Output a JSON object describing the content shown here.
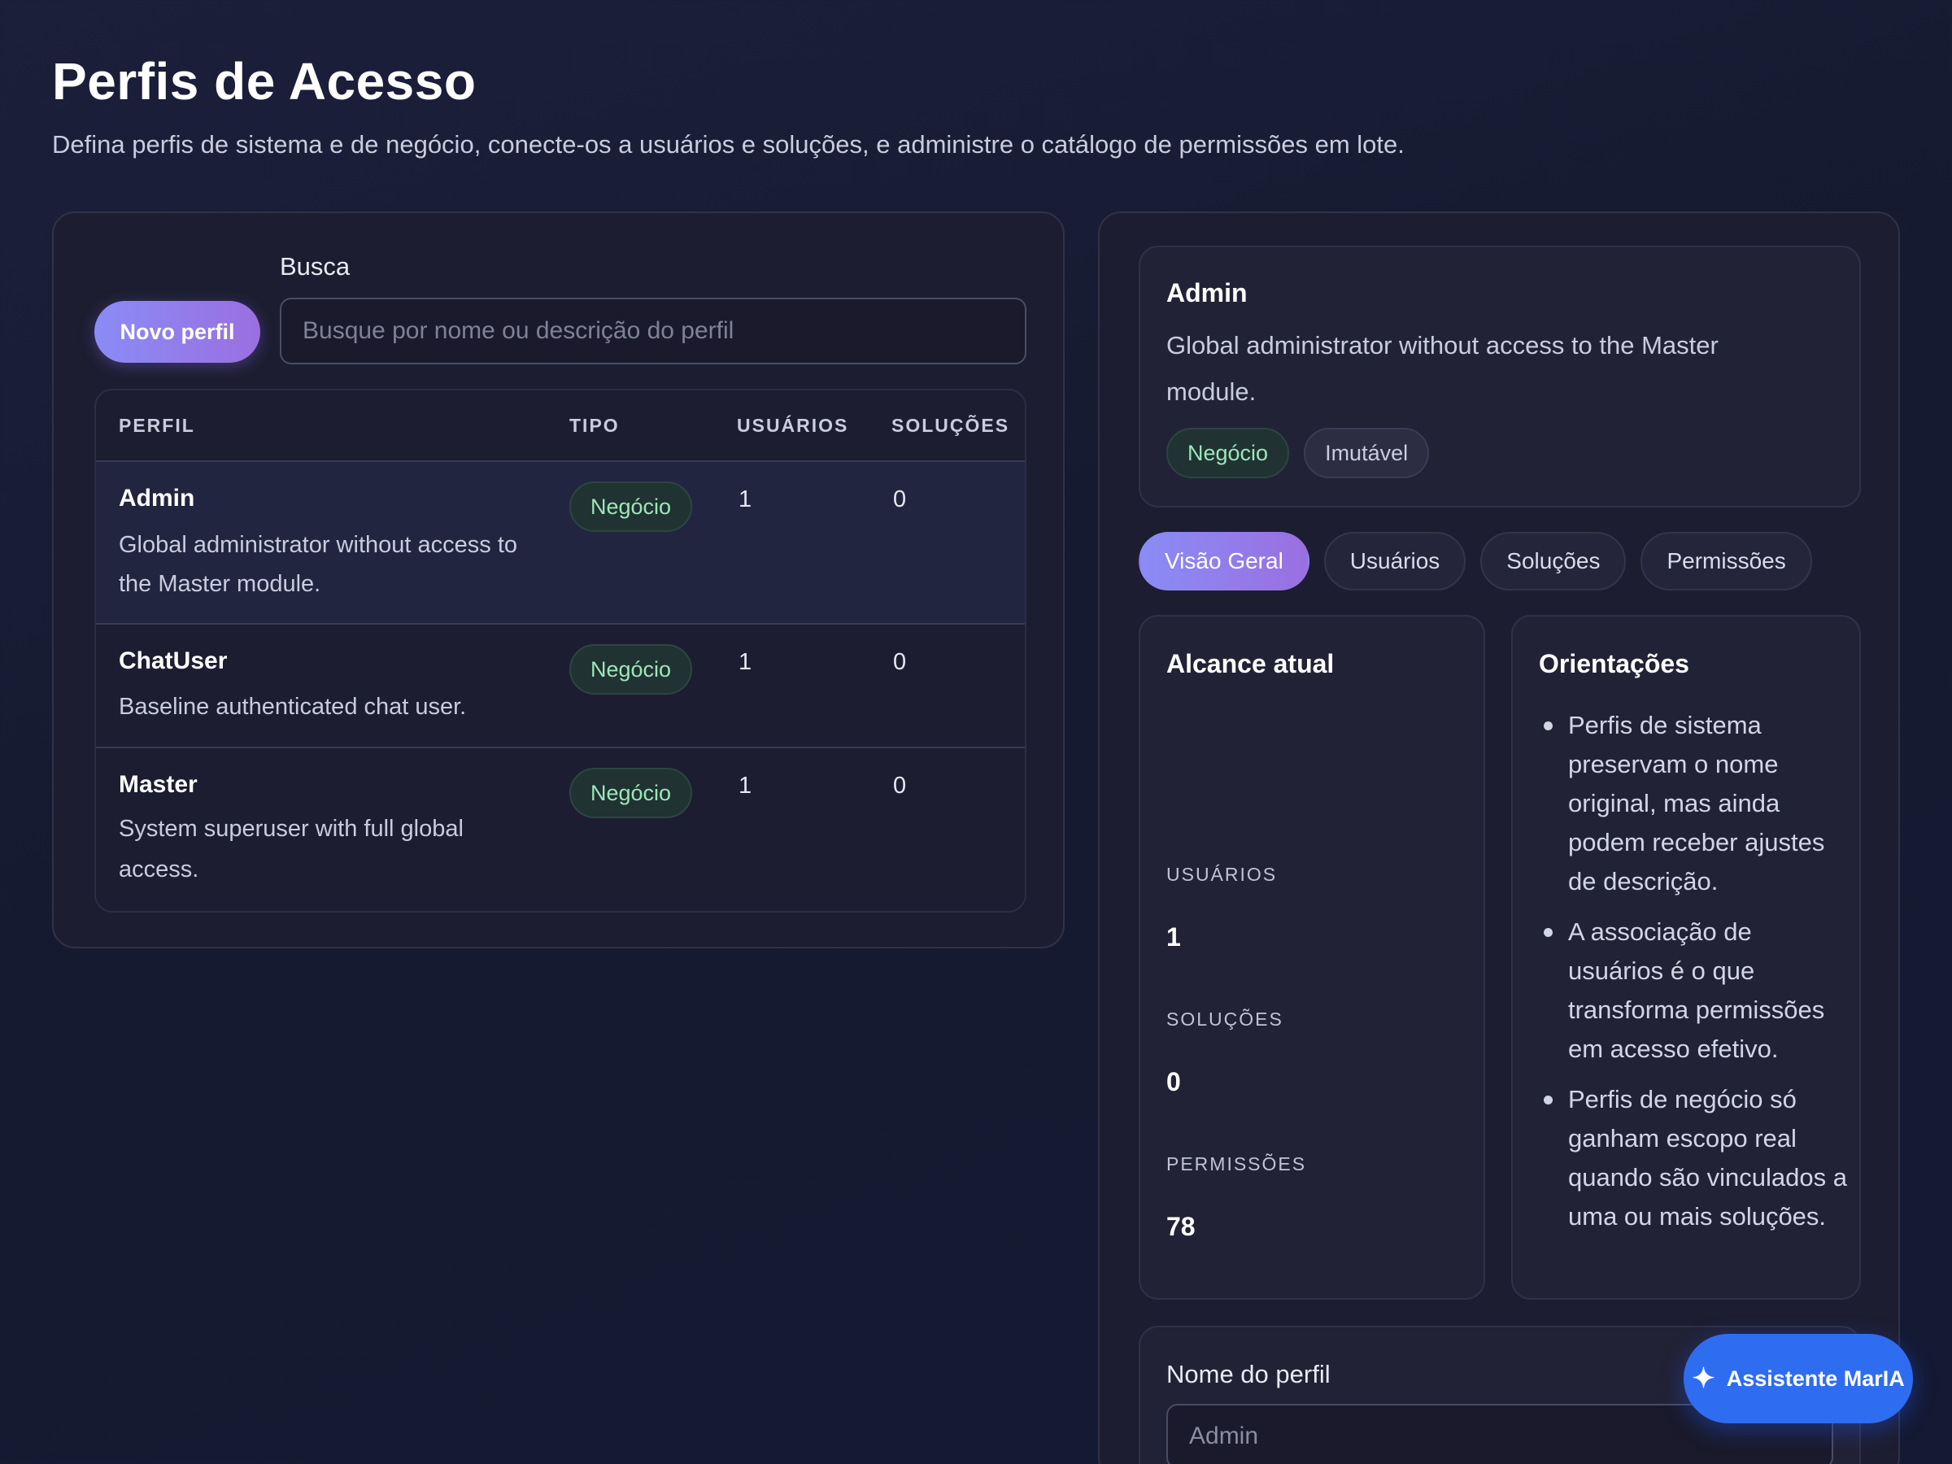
{
  "header": {
    "title": "Perfis de Acesso",
    "subtitle": "Defina perfis de sistema e de negócio, conecte-os a usuários e soluções, e administre o catálogo de permissões em lote."
  },
  "list": {
    "new_button": "Novo perfil",
    "search_label": "Busca",
    "search_placeholder": "Busque por nome ou descrição do perfil",
    "columns": {
      "profile": "PERFIL",
      "type": "TIPO",
      "users": "USUÁRIOS",
      "solutions": "SOLUÇÕES"
    },
    "rows": [
      {
        "name": "Admin",
        "description": "Global administrator without access to the Master module.",
        "type": "Negócio",
        "users": "1",
        "solutions": "0"
      },
      {
        "name": "ChatUser",
        "description": "Baseline authenticated chat user.",
        "type": "Negócio",
        "users": "1",
        "solutions": "0"
      },
      {
        "name": "Master",
        "description": "System superuser with full global access.",
        "type": "Negócio",
        "users": "1",
        "solutions": "0"
      }
    ]
  },
  "detail": {
    "name": "Admin",
    "description": "Global administrator without access to the Master module.",
    "type_badge": "Negócio",
    "immutable_badge": "Imutável",
    "tabs": [
      "Visão Geral",
      "Usuários",
      "Soluções",
      "Permissões"
    ],
    "reach": {
      "title": "Alcance atual",
      "users_label": "USUÁRIOS",
      "users_value": "1",
      "solutions_label": "SOLUÇÕES",
      "solutions_value": "0",
      "permissions_label": "PERMISSÕES",
      "permissions_value": "78"
    },
    "guidance": {
      "title": "Orientações",
      "items": [
        "Perfis de sistema preservam o nome original, mas ainda podem receber ajustes de descrição.",
        "A associação de usuários é o que transforma permissões em acesso efetivo.",
        "Perfis de negócio só ganham escopo real quando são vinculados a uma ou mais soluções."
      ]
    },
    "form": {
      "name_label": "Nome do perfil",
      "name_placeholder": "Admin"
    }
  },
  "assistant": {
    "label": "Assistente MarIA",
    "icon": "sparkle-icon"
  },
  "colors": {
    "accent_start": "#8a8cf6",
    "accent_end": "#9a6fe0",
    "assistant": "#2f6df0",
    "badge_green_text": "#9ee6b8"
  }
}
